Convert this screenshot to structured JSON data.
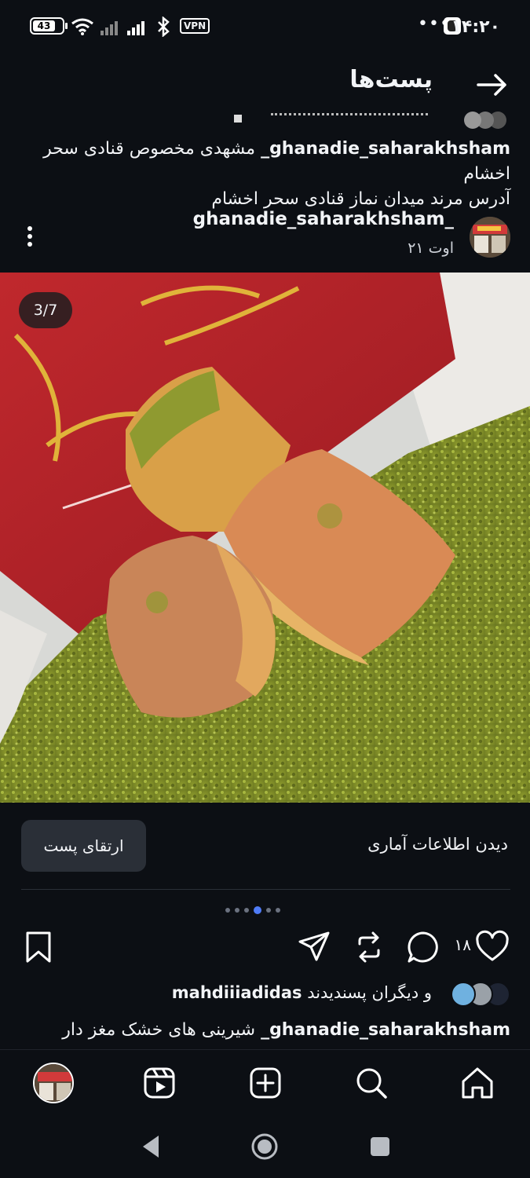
{
  "status_bar": {
    "battery": "43",
    "vpn": "VPN",
    "time": "۱۴:۲۰",
    "dots": "•••"
  },
  "header": {
    "title": "پست‌ها"
  },
  "previous_post": {
    "username": "ghanadie_saharakhsham_",
    "caption_line1": "مشهدی مخصوص قنادی سحر اخشام",
    "caption_line2": "آدرس مرند میدان نماز قنادی سحر اخشام"
  },
  "post": {
    "username": "ghanadie_saharakhsham_",
    "date": "۲۱ اوت",
    "image_counter": "3/7",
    "carousel": {
      "count": 6,
      "active_index": 3
    },
    "stats_link": "دیدن اطلاعات آماری",
    "boost_button": "ارتقای پست",
    "like_count": "۱۸",
    "likes_prefix": "و دیگران پسندیدند",
    "liker_username": "mahdiiiadidas",
    "caption_username": "ghanadie_saharakhsham_",
    "caption_text": "شیرینی های خشک مغز دار"
  },
  "icons": {
    "back": "arrow-right-icon",
    "menu": "kebab-menu-icon",
    "like": "heart-icon",
    "comment": "comment-icon",
    "repost": "repost-icon",
    "share": "send-icon",
    "save": "bookmark-icon",
    "home": "home-icon",
    "search": "search-icon",
    "create": "plus-square-icon",
    "reels": "reels-icon",
    "profile": "profile-avatar"
  },
  "colors": {
    "background": "#0c0f14",
    "accent": "#4f7cf7",
    "button": "#2a2f37"
  }
}
